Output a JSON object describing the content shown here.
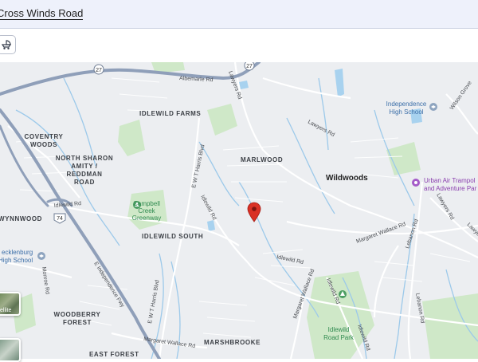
{
  "topbar": {
    "address": "Cross Winds Road"
  },
  "toolbar": {
    "tool_icon": "stroller-icon"
  },
  "map": {
    "marker_icon": "map-pin-icon",
    "colors": {
      "water": "#a8d2ef",
      "park": "#cfe8c8",
      "highway": "#8f9fb9",
      "street": "#ffffff",
      "marker": "#d93025"
    },
    "neighborhoods": {
      "idlewild_farms": "IDLEWILD FARMS",
      "coventry_1": "COVENTRY",
      "coventry_2": "WOODS",
      "nsa_1": "NORTH SHARON",
      "nsa_2": "AMITY /",
      "nsa_3": "REDDMAN",
      "nsa_4": "ROAD",
      "marlwood": "MARLWOOD",
      "wynnwood": "WYNNWOOD",
      "idlewild_south": "IDLEWILD SOUTH",
      "woodberry_1": "WOODBERRY",
      "woodberry_2": "FOREST",
      "east_forest": "EAST FOREST",
      "marshbrooke": "MARSHBROOKE"
    },
    "towns": {
      "wildwoods": "Wildwoods"
    },
    "schools": {
      "independence_1": "Independence",
      "independence_2": "High School",
      "mecklenburg_1": "ecklenburg",
      "mecklenburg_2": "High School"
    },
    "parks": {
      "campbell_1": "Campbell",
      "campbell_2": "Creek",
      "campbell_3": "Greenway",
      "idlewild_park_1": "Idlewild",
      "idlewild_park_2": "Road Park"
    },
    "attractions": {
      "urban_air_1": "Urban Air Trampol",
      "urban_air_2": "and Adventure Par"
    },
    "roads": {
      "albemarle": "Albemarle Rd",
      "lawyers_1": "Lawyers Rd",
      "lawyers_2": "Lawyers Rd",
      "lawyers_3": "Lawyers Rd",
      "lawyers_4": "Lawye",
      "harris_1": "E W T Harris Blvd",
      "harris_2": "E W T Harris Blvd",
      "idlewild_1": "Idlewild Rd",
      "idlewild_2": "Idlewild Rd",
      "idlewild_3": "Idlewild Rd",
      "idlewild_4": "Idlewild Rd",
      "idlewild_5": "Idlewild Rd",
      "independence_fwy": "E Independence Fwy",
      "monroe": "Monroe Rd",
      "margaret_1": "Margaret Wallace Rd",
      "margaret_2": "Margaret Wallace Rd",
      "margaret_3": "Margaret Wallace Rd",
      "lebanon_1": "Lebanon Rd",
      "lebanon_2": "Lebanon Rd",
      "wilson": "Wilson Grove"
    },
    "shields": {
      "hwy27_a": "27",
      "hwy27_b": "27",
      "hwy74": "74"
    },
    "layers": {
      "satellite_label": "ellite"
    }
  }
}
